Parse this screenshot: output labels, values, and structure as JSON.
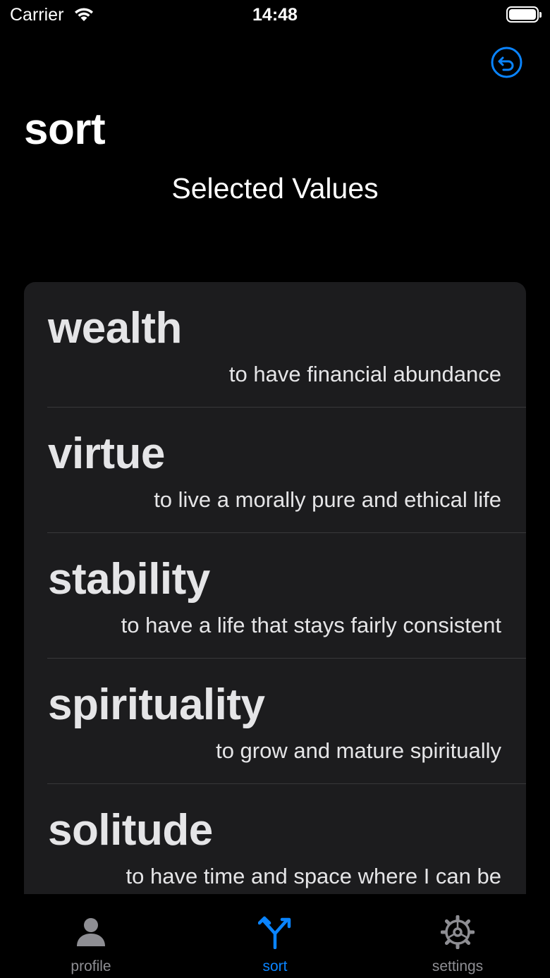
{
  "status_bar": {
    "carrier": "Carrier",
    "time": "14:48"
  },
  "header": {
    "title": "sort",
    "section_title": "Selected Values"
  },
  "values": [
    {
      "name": "wealth",
      "description": "to have financial abundance"
    },
    {
      "name": "virtue",
      "description": "to live a morally pure and ethical life"
    },
    {
      "name": "stability",
      "description": "to have a life that stays fairly consistent"
    },
    {
      "name": "spirituality",
      "description": "to grow and mature spiritually"
    },
    {
      "name": "solitude",
      "description": "to have time and space where I can be"
    }
  ],
  "tab_bar": {
    "tabs": [
      {
        "label": "profile",
        "icon": "person-icon",
        "selected": false
      },
      {
        "label": "sort",
        "icon": "fork-arrows-icon",
        "selected": true
      },
      {
        "label": "settings",
        "icon": "gear-icon",
        "selected": false
      }
    ]
  },
  "colors": {
    "accent": "#0a84ff",
    "inactive": "#8e8e93",
    "card": "#1c1c1e",
    "background": "#000000"
  }
}
